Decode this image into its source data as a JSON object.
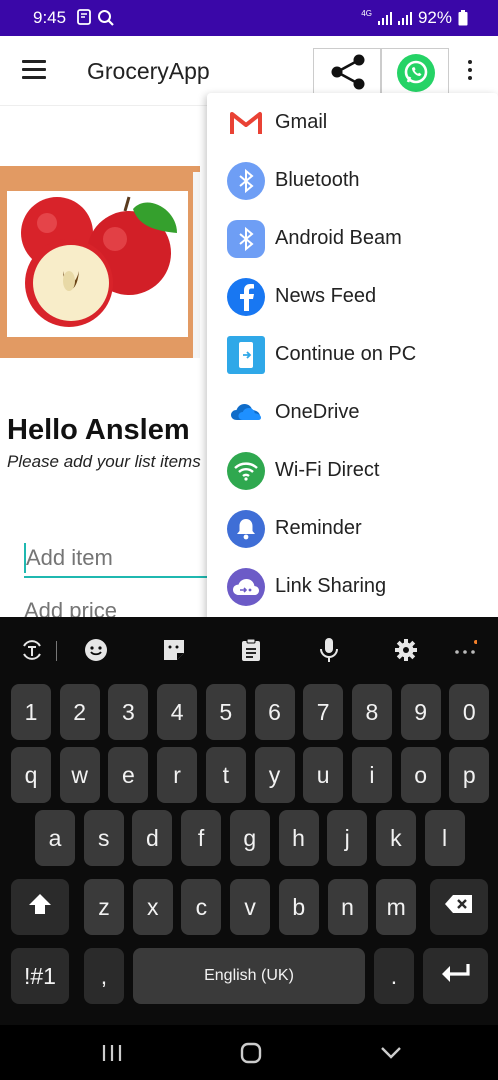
{
  "status_bar": {
    "time": "9:45",
    "network": "4G",
    "battery": "92%"
  },
  "app_bar": {
    "title": "GroceryApp",
    "icons": [
      "menu-icon",
      "share-icon",
      "whatsapp-icon",
      "more-vert-icon"
    ]
  },
  "main": {
    "greeting": "Hello Anslem",
    "subtitle": "Please add your list items",
    "item_placeholder": "Add item",
    "price_placeholder": "Add price"
  },
  "share_menu": {
    "items": [
      {
        "label": "Gmail",
        "icon": "gmail-icon"
      },
      {
        "label": "Bluetooth",
        "icon": "bluetooth-icon"
      },
      {
        "label": "Android Beam",
        "icon": "android-beam-icon"
      },
      {
        "label": "News Feed",
        "icon": "facebook-icon"
      },
      {
        "label": "Continue on PC",
        "icon": "continue-on-pc-icon"
      },
      {
        "label": "OneDrive",
        "icon": "onedrive-icon"
      },
      {
        "label": "Wi-Fi Direct",
        "icon": "wifi-direct-icon"
      },
      {
        "label": "Reminder",
        "icon": "reminder-icon"
      },
      {
        "label": "Link Sharing",
        "icon": "link-sharing-icon"
      }
    ]
  },
  "keyboard": {
    "number_row": [
      "1",
      "2",
      "3",
      "4",
      "5",
      "6",
      "7",
      "8",
      "9",
      "0"
    ],
    "row1": [
      "q",
      "w",
      "e",
      "r",
      "t",
      "y",
      "u",
      "i",
      "o",
      "p"
    ],
    "row2": [
      "a",
      "s",
      "d",
      "f",
      "g",
      "h",
      "j",
      "k",
      "l"
    ],
    "row3": [
      "z",
      "x",
      "c",
      "v",
      "b",
      "n",
      "m"
    ],
    "symbols_key": "!#1",
    "comma_key": ",",
    "space_label": "English (UK)",
    "period_key": "."
  },
  "colors": {
    "status_bar": "#3a07a8",
    "accent": "#1fb8b0",
    "whatsapp": "#25d366",
    "banner": "#e29a63"
  }
}
